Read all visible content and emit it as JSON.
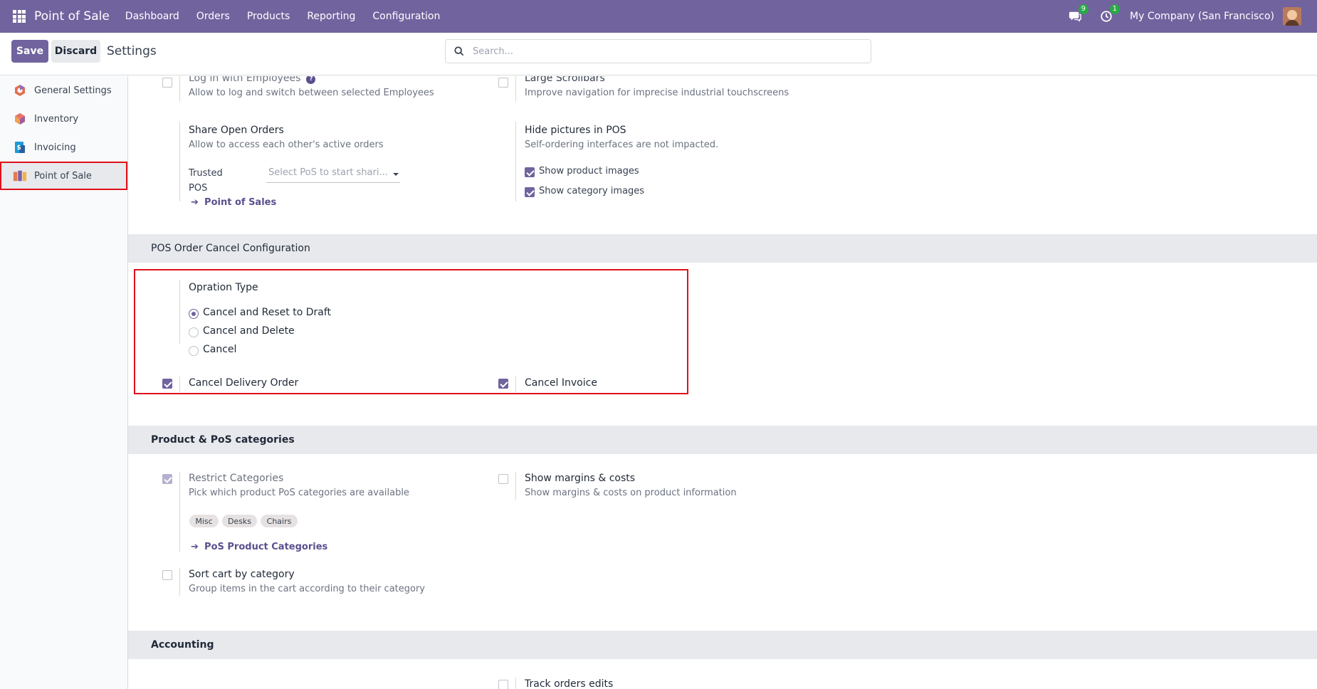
{
  "navbar": {
    "app_name": "Point of Sale",
    "menu": [
      "Dashboard",
      "Orders",
      "Products",
      "Reporting",
      "Configuration"
    ],
    "messages_count": "9",
    "activities_count": "1",
    "company": "My Company (San Francisco)"
  },
  "control": {
    "save_label": "Save",
    "discard_label": "Discard",
    "title": "Settings",
    "search_placeholder": "Search..."
  },
  "sidebar": {
    "items": [
      {
        "label": "General Settings",
        "icon": "general-settings-icon"
      },
      {
        "label": "Inventory",
        "icon": "inventory-icon"
      },
      {
        "label": "Invoicing",
        "icon": "invoicing-icon"
      },
      {
        "label": "Point of Sale",
        "icon": "point-of-sale-icon"
      }
    ]
  },
  "pos_settings": {
    "login_employees": {
      "title": "Log in with Employees",
      "desc": "Allow to log and switch between selected Employees"
    },
    "large_scrollbars": {
      "title": "Large Scrollbars",
      "desc": "Improve navigation for imprecise industrial touchscreens"
    },
    "share_open_orders": {
      "title": "Share Open Orders",
      "desc": "Allow to access each other's active orders",
      "trusted_label": "Trusted POS",
      "select_placeholder": "Select PoS to start shari...",
      "link": "Point of Sales"
    },
    "hide_pictures": {
      "title": "Hide pictures in POS",
      "desc": "Self-ordering interfaces are not impacted.",
      "show_product": "Show product images",
      "show_category": "Show category images"
    }
  },
  "cancel_config": {
    "section_title": "POS Order Cancel Configuration",
    "operation_type_label": "Opration Type",
    "options": [
      "Cancel and Reset to Draft",
      "Cancel and Delete",
      "Cancel"
    ],
    "selected_option": "Cancel and Reset to Draft",
    "cancel_delivery": "Cancel Delivery Order",
    "cancel_invoice": "Cancel Invoice"
  },
  "categories": {
    "section_title": "Product & PoS categories",
    "restrict": {
      "title": "Restrict Categories",
      "desc": "Pick which product PoS categories are available",
      "tags": [
        "Misc",
        "Desks",
        "Chairs"
      ],
      "link": "PoS Product Categories"
    },
    "margins": {
      "title": "Show margins & costs",
      "desc": "Show margins & costs on product information"
    },
    "sort_cart": {
      "title": "Sort cart by category",
      "desc": "Group items in the cart according to their category"
    }
  },
  "accounting": {
    "section_title": "Accounting",
    "track_orders": "Track orders edits"
  },
  "colors": {
    "brand": "#71639e",
    "highlight": "#e0101a",
    "badge": "#29a845"
  }
}
